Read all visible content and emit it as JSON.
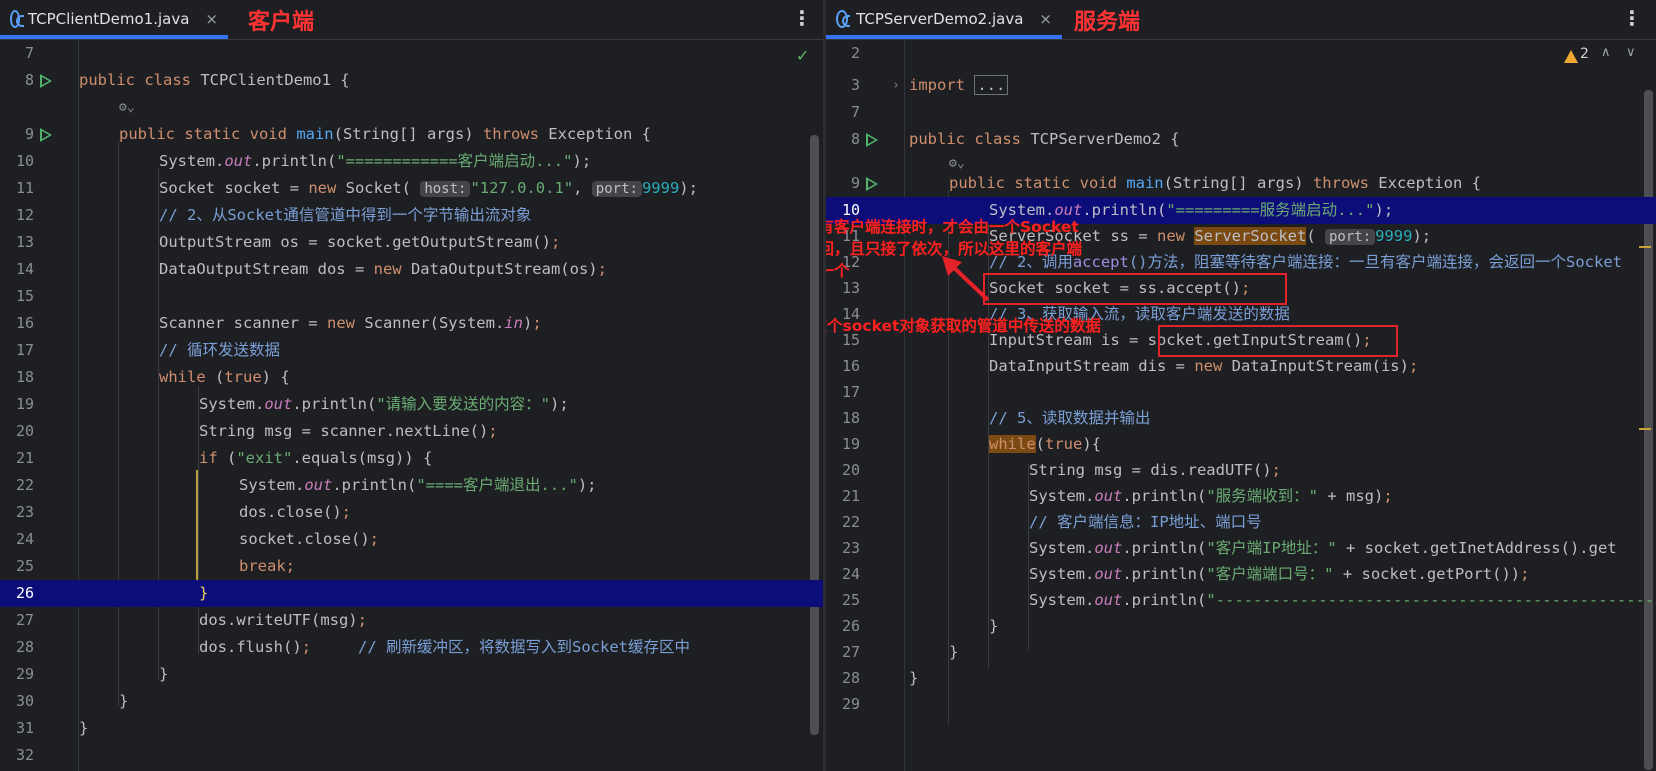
{
  "left": {
    "tab": {
      "label": "TCPClientDemo1.java",
      "close": "×"
    },
    "annotation": "客户端",
    "menu": "⋮",
    "lines": [
      {
        "n": "7"
      },
      {
        "n": "8"
      },
      {
        "n": ""
      },
      {
        "n": "9"
      },
      {
        "n": "10"
      },
      {
        "n": "11"
      },
      {
        "n": "12"
      },
      {
        "n": "13"
      },
      {
        "n": "14"
      },
      {
        "n": "15"
      },
      {
        "n": "16"
      },
      {
        "n": "17"
      },
      {
        "n": "18"
      },
      {
        "n": "19"
      },
      {
        "n": "20"
      },
      {
        "n": "21"
      },
      {
        "n": "22"
      },
      {
        "n": "23"
      },
      {
        "n": "24"
      },
      {
        "n": "25"
      },
      {
        "n": "26"
      },
      {
        "n": "27"
      },
      {
        "n": "28"
      },
      {
        "n": "29"
      },
      {
        "n": "30"
      },
      {
        "n": "31"
      },
      {
        "n": "32"
      }
    ],
    "code": {
      "l8a": "public class ",
      "l8b": "TCPClientDemo1 {",
      "l9a": "public static void ",
      "l9b": "main",
      "l9c": "(String[] args) ",
      "l9d": "throws",
      "l9e": " Exception {",
      "l10a": "System.",
      "l10b": "out",
      "l10c": ".println(",
      "l10d": "\"============客户端启动...\"",
      "l10e": ");",
      "l11a": "Socket socket = ",
      "l11b": "new",
      "l11c": " Socket( ",
      "l11d": "host:",
      "l11e": "\"127.0.0.1\"",
      "l11f": ", ",
      "l11g": "port:",
      "l11h": "9999",
      "l11i": ");",
      "l12": "// 2、从Socket通信管道中得到一个字节输出流对象",
      "l13a": "OutputStream os = socket.getOutputStream()",
      "l13b": ";",
      "l14a": "DataOutputStream dos = ",
      "l14b": "new",
      "l14c": " DataOutputStream(os)",
      "l14d": ";",
      "l16a": "Scanner scanner = ",
      "l16b": "new",
      "l16c": " Scanner(System.",
      "l16d": "in",
      "l16e": ")",
      "l16f": ";",
      "l17": "// 循环发送数据",
      "l18a": "while",
      "l18b": " (",
      "l18c": "true",
      "l18d": ") {",
      "l19a": "System.",
      "l19b": "out",
      "l19c": ".println(",
      "l19d": "\"请输入要发送的内容：\"",
      "l19e": ");",
      "l20a": "String msg = scanner.nextLine()",
      "l20b": ";",
      "l21a": "if",
      "l21b": " (",
      "l21c": "\"exit\"",
      "l21d": ".equals(msg)) {",
      "l22a": "System.",
      "l22b": "out",
      "l22c": ".println(",
      "l22d": "\"====客户端退出...\"",
      "l22e": ");",
      "l23a": "dos.close()",
      "l23b": ";",
      "l24a": "socket.close()",
      "l24b": ";",
      "l25a": "break",
      "l25b": ";",
      "l26": "}",
      "l27a": "dos.writeUTF(msg)",
      "l27b": ";",
      "l28a": "dos.flush()",
      "l28b": ";",
      "l28c": "// 刷新缓冲区，将数据写入到Socket缓存区中",
      "l29": "}",
      "l30": "}",
      "l31": "}"
    }
  },
  "right": {
    "tab": {
      "label": "TCPServerDemo2.java",
      "close": "×"
    },
    "annotation": "服务端",
    "menu": "⋮",
    "warnings": "2",
    "lines": [
      {
        "n": "2"
      },
      {
        "n": "3"
      },
      {
        "n": "7"
      },
      {
        "n": "8"
      },
      {
        "n": ""
      },
      {
        "n": "9"
      },
      {
        "n": "10"
      },
      {
        "n": "11"
      },
      {
        "n": "12"
      },
      {
        "n": "13"
      },
      {
        "n": "14"
      },
      {
        "n": "15"
      },
      {
        "n": "16"
      },
      {
        "n": "17"
      },
      {
        "n": "18"
      },
      {
        "n": "19"
      },
      {
        "n": "20"
      },
      {
        "n": "21"
      },
      {
        "n": "22"
      },
      {
        "n": "23"
      },
      {
        "n": "24"
      },
      {
        "n": "25"
      },
      {
        "n": "26"
      },
      {
        "n": "27"
      },
      {
        "n": "28"
      },
      {
        "n": "29"
      }
    ],
    "code": {
      "l3a": "import",
      "l3b": "...",
      "l8a": "public class ",
      "l8b": "TCPServerDemo2 {",
      "l9a": "public static void ",
      "l9b": "main",
      "l9c": "(String[] args) ",
      "l9d": "throws",
      "l9e": " Exception {",
      "l10a": "System.",
      "l10b": "out",
      "l10c": ".println(",
      "l10d": "\"=========服务端启动...\"",
      "l10e": ");",
      "l11a": "ServerSocket ss = ",
      "l11b": "new",
      "l11c": " ",
      "l11d": "ServerSocket",
      "l11e": "( ",
      "l11f": "port:",
      "l11g": "9999",
      "l11h": ");",
      "l12a": "// 2、调用",
      "l12b": "accept",
      "l12c": "()方法，阻塞等待客户端连接：一旦有客户端连接，会返回一个Socket",
      "l13a": "Socket socket = ss.accept()",
      "l13b": ";",
      "l14": "// 3、获取输入流，读取客户端发送的数据",
      "l15a": "InputStream is = ",
      "l15b": "socket.getInputStream()",
      "l15c": ";",
      "l16a": "DataInputStream dis = ",
      "l16b": "new",
      "l16c": " DataInputStream(is)",
      "l16d": ";",
      "l18": "// 5、读取数据并输出",
      "l19a": "while",
      "l19b": "(",
      "l19c": "true",
      "l19d": "){",
      "l20a": "String msg = dis.readUTF()",
      "l20b": ";",
      "l21a": "System.",
      "l21b": "out",
      "l21c": ".println(",
      "l21d": "\"服务端收到：\"",
      "l21e": " + msg)",
      "l21f": ";",
      "l22": "// 客户端信息：IP地址、端口号",
      "l23a": "System.",
      "l23b": "out",
      "l23c": ".println(",
      "l23d": "\"客户端IP地址：\"",
      "l23e": " + socket.getInetAddress().get",
      "l24a": "System.",
      "l24b": "out",
      "l24c": ".println(",
      "l24d": "\"客户端端口号：\"",
      "l24e": " + socket.getPort())",
      "l24f": ";",
      "l25a": "System.",
      "l25b": "out",
      "l25c": ".println(",
      "l25d": "\"--------------------------------------------------",
      "l26": "}",
      "l27": "}",
      "l28": "}"
    },
    "notes": {
      "accept_note_1": "这里是有客户端连接时，才会由一个Socket",
      "accept_note_2": "对象返回，且只接了依次，所以这里的客户端",
      "accept_note_3": "只能有一个",
      "stream_note": "后面也是用这个socket对象获取的管道中传送的数据"
    }
  }
}
